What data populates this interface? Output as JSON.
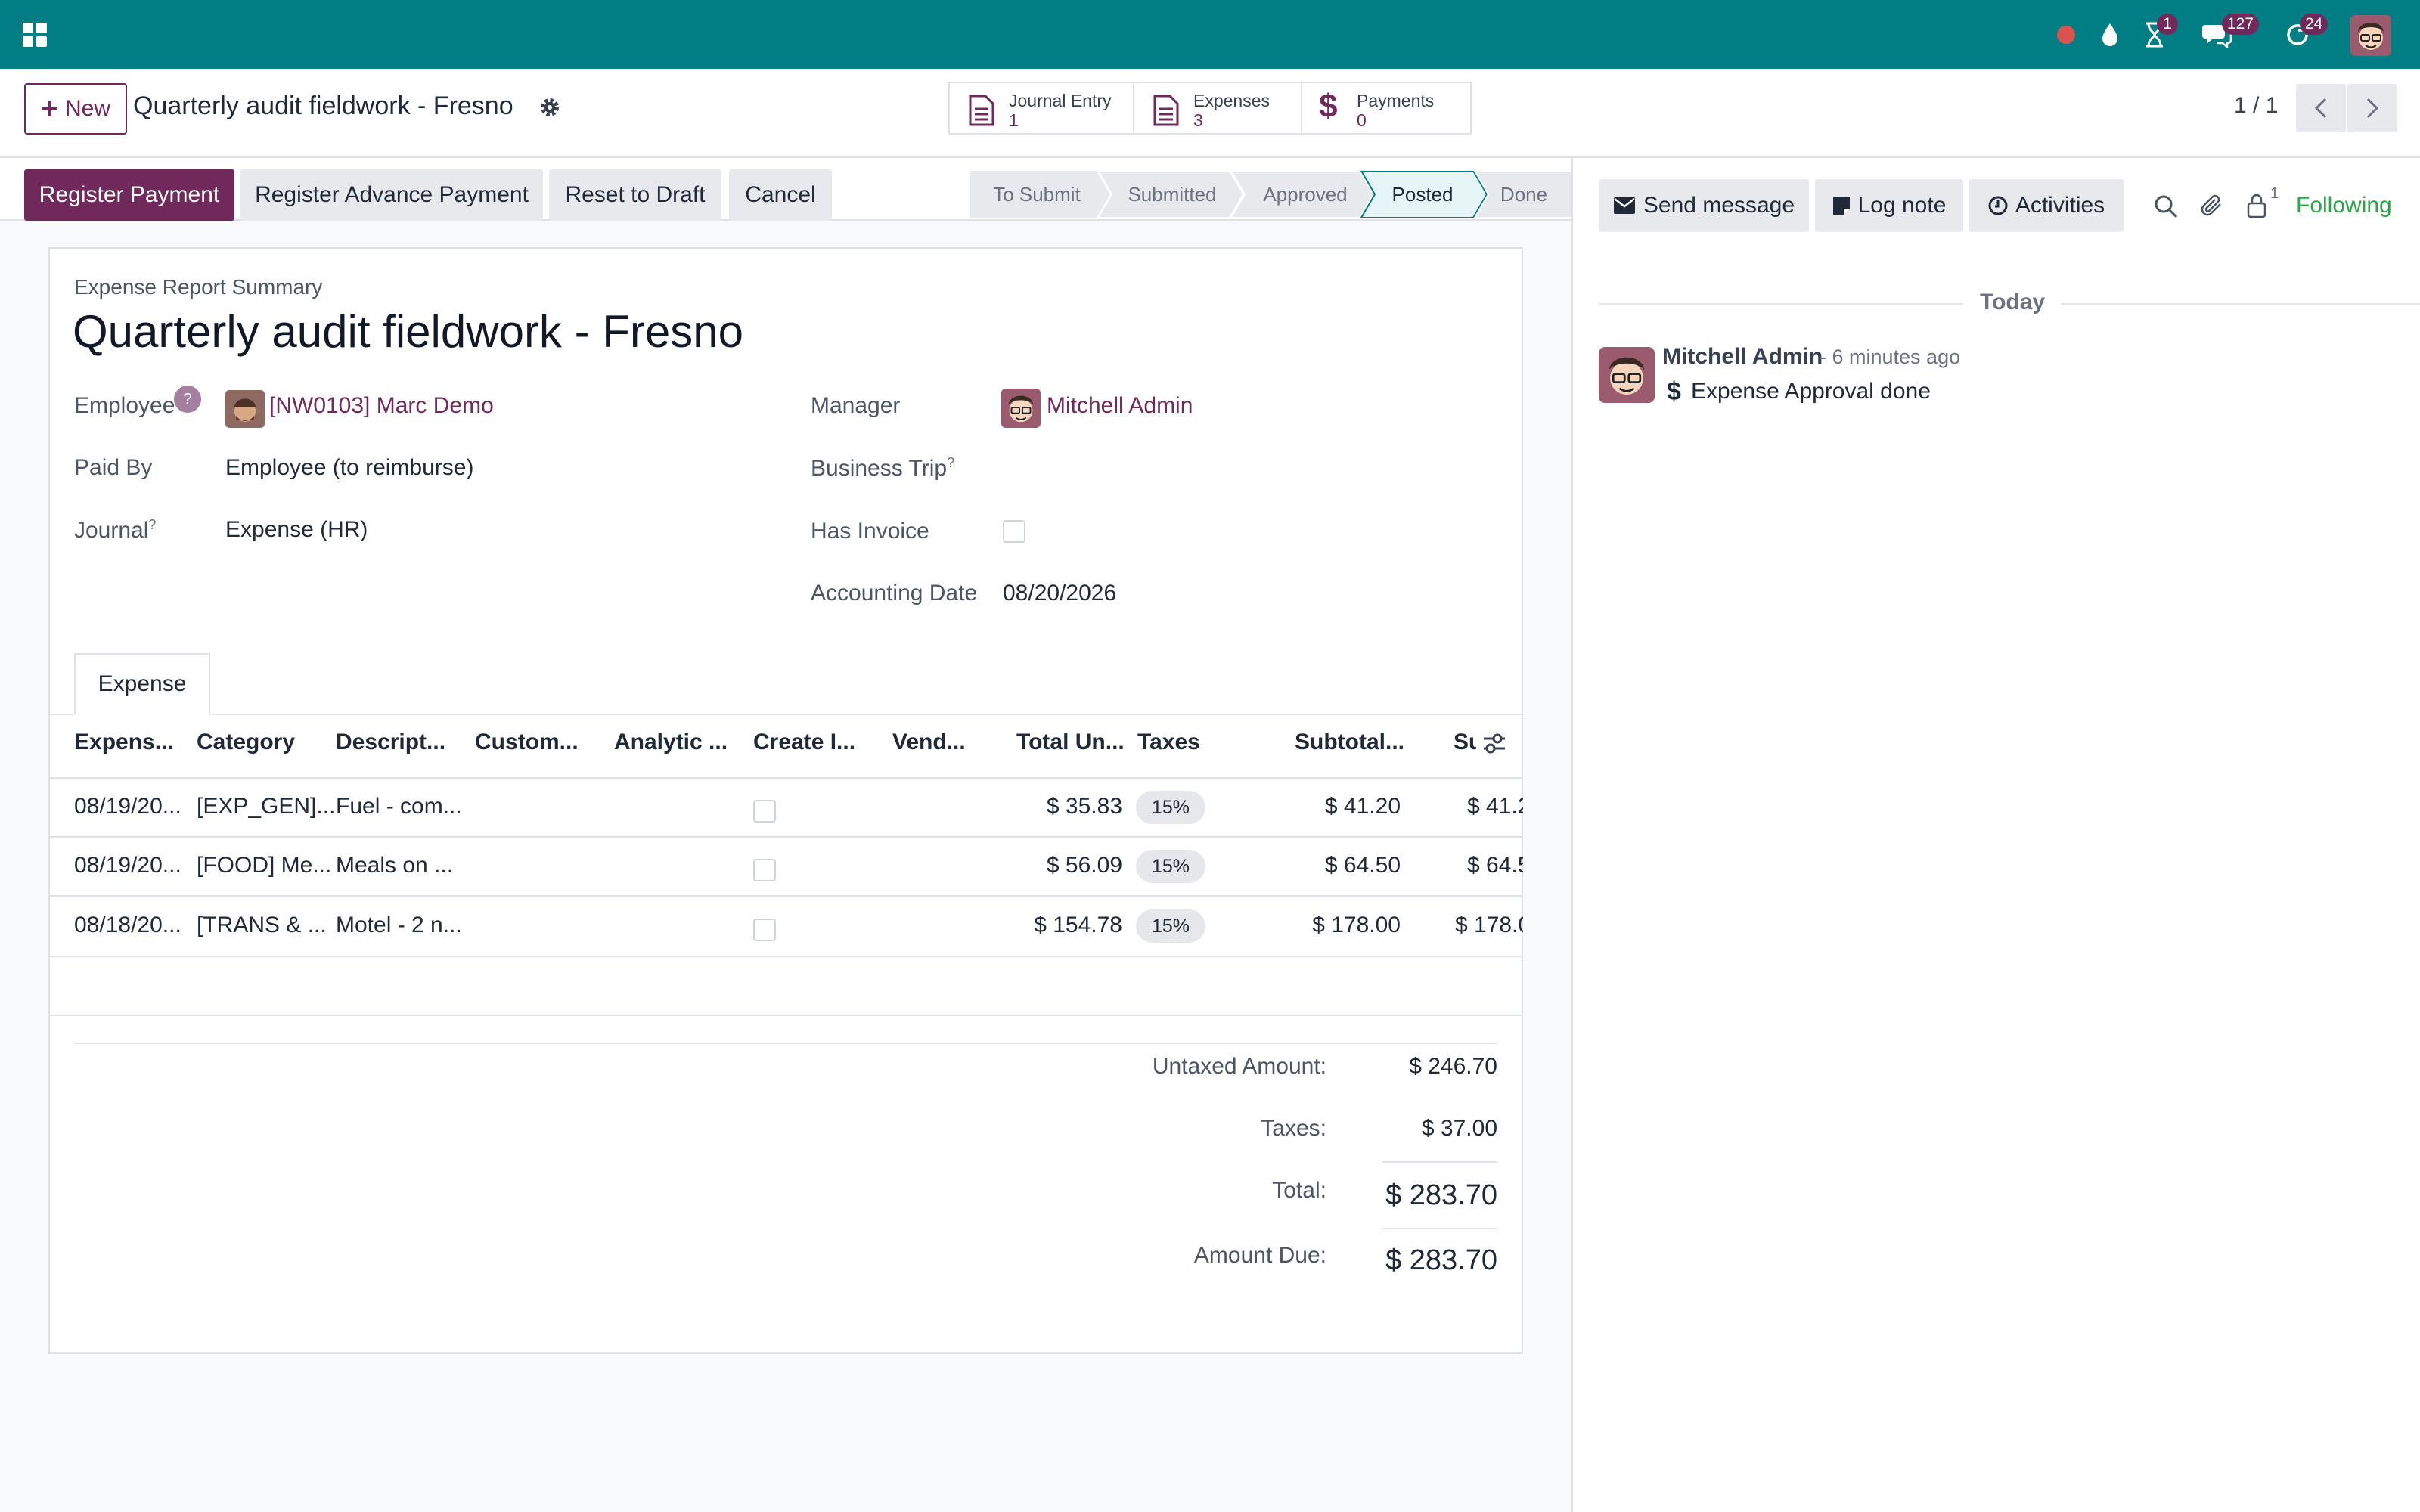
{
  "navbar": {
    "apps_icon": "grid-icon",
    "badges": {
      "activities": "1",
      "messages": "127",
      "updates": "24"
    },
    "colors": {
      "bar": "#017e84",
      "badge": "#71295b"
    }
  },
  "control": {
    "new_label": "New",
    "record_title": "Quarterly audit fieldwork - Fresno",
    "smart_buttons": [
      {
        "label": "Journal Entry",
        "value": "1",
        "icon": "document-icon"
      },
      {
        "label": "Expenses",
        "value": "3",
        "icon": "document-icon"
      },
      {
        "label": "Payments",
        "value": "0",
        "icon": "dollar-icon"
      }
    ],
    "pager": "1 / 1"
  },
  "actions": {
    "register_payment": "Register Payment",
    "register_advance": "Register Advance Payment",
    "reset_to_draft": "Reset to Draft",
    "cancel": "Cancel"
  },
  "statusbar": {
    "stages": [
      "To Submit",
      "Submitted",
      "Approved",
      "Posted",
      "Done"
    ],
    "active": "Posted"
  },
  "form": {
    "summary_label": "Expense Report Summary",
    "title": "Quarterly audit fieldwork - Fresno",
    "employee_label": "Employee",
    "employee_help": "?",
    "employee_value": "[NW0103] Marc Demo",
    "paid_by_label": "Paid By",
    "paid_by_value": "Employee (to reimburse)",
    "journal_label": "Journal",
    "journal_value": "Expense (HR)",
    "manager_label": "Manager",
    "manager_value": "Mitchell Admin",
    "business_trip_label": "Business Trip",
    "has_invoice_label": "Has Invoice",
    "accounting_date_label": "Accounting Date",
    "accounting_date_value": "08/20/2026",
    "help_mark": "?"
  },
  "tab": {
    "label": "Expense"
  },
  "table": {
    "headers": [
      "Expens...",
      "Category",
      "Descript...",
      "Custom...",
      "Analytic ...",
      "Create I...",
      "Vend...",
      "Total Un...",
      "Taxes",
      "Subtotal...",
      "Su"
    ],
    "rows": [
      {
        "date": "08/19/20...",
        "category": "[EXP_GEN]...",
        "description": "Fuel - com...",
        "total": "$ 35.83",
        "tax": "15%",
        "subtotal": "$ 41.20",
        "sub2": "$ 41.2"
      },
      {
        "date": "08/19/20...",
        "category": "[FOOD] Me...",
        "description": "Meals on ...",
        "total": "$ 56.09",
        "tax": "15%",
        "subtotal": "$ 64.50",
        "sub2": "$ 64.5"
      },
      {
        "date": "08/18/20...",
        "category": "[TRANS & ...",
        "description": "Motel - 2 n...",
        "total": "$ 154.78",
        "tax": "15%",
        "subtotal": "$ 178.00",
        "sub2": "$ 178.0"
      }
    ]
  },
  "totals": {
    "untaxed_label": "Untaxed Amount:",
    "untaxed_value": "$ 246.70",
    "taxes_label": "Taxes:",
    "taxes_value": "$ 37.00",
    "total_label": "Total:",
    "total_value": "$ 283.70",
    "due_label": "Amount Due:",
    "due_value": "$ 283.70"
  },
  "chatter": {
    "send_message": "Send message",
    "log_note": "Log note",
    "activities": "Activities",
    "followers_count": "1",
    "following": "Following",
    "date_separator": "Today",
    "message": {
      "author": "Mitchell Admin",
      "time": "- 6 minutes ago",
      "body": "Expense Approval done"
    }
  }
}
